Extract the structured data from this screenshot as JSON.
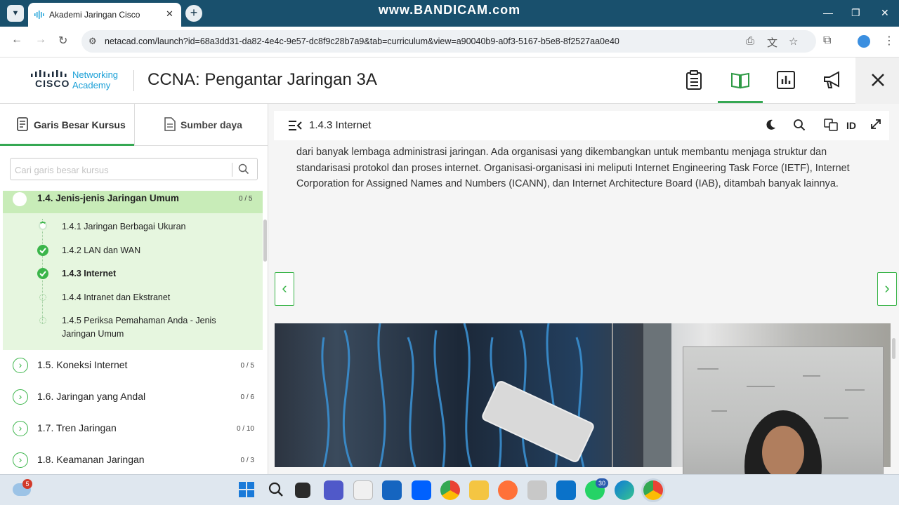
{
  "browser": {
    "tab_title": "Akademi Jaringan Cisco",
    "watermark": "www.BANDICAM.com",
    "url": "netacad.com/launch?id=68a3dd31-da82-4e4c-9e57-dc8f9c28b7a9&tab=curriculum&view=a90040b9-a0f3-5167-b5e8-8f2527aa0e40"
  },
  "header": {
    "logo_line1": "Networking",
    "logo_line2": "Academy",
    "cisco_word": "CISCO",
    "course_title": "CCNA: Pengantar Jaringan 3A"
  },
  "sidebar": {
    "tab_outline": "Garis Besar Kursus",
    "tab_resources": "Sumber daya",
    "search_placeholder": "Cari garis besar kursus",
    "active_module": {
      "title": "1.4. Jenis-jenis Jaringan Umum",
      "count": "0 / 5",
      "lessons": [
        {
          "label": "1.4.1 Jaringan Berbagai Ukuran",
          "status": "partial"
        },
        {
          "label": "1.4.2 LAN dan WAN",
          "status": "done"
        },
        {
          "label": "1.4.3 Internet",
          "status": "done"
        },
        {
          "label": "1.4.4 Intranet dan Ekstranet",
          "status": "empty"
        },
        {
          "label": "1.4.5 Periksa Pemahaman Anda - Jenis Jaringan Umum",
          "status": "empty"
        }
      ]
    },
    "modules": [
      {
        "title": "1.5. Koneksi Internet",
        "count": "0 / 5"
      },
      {
        "title": "1.6. Jaringan yang Andal",
        "count": "0 / 6"
      },
      {
        "title": "1.7. Tren Jaringan",
        "count": "0 / 10"
      },
      {
        "title": "1.8. Keamanan Jaringan",
        "count": "0 / 3"
      }
    ]
  },
  "content": {
    "lesson_title": "1.4.3 Internet",
    "lang_code": "ID",
    "paragraph": "dari banyak lembaga administrasi jaringan. Ada organisasi yang dikembangkan untuk membantu menjaga struktur dan standarisasi protokol dan proses internet. Organisasi-organisasi ini meliputi Internet Engineering Task Force (IETF), Internet Corporation for Assigned Names and Numbers (ICANN), dan Internet Architecture Board (IAB), ditambah banyak lainnya."
  },
  "taskbar": {
    "weather_badge": "5",
    "whatsapp_badge": "30"
  },
  "colors": {
    "accent_green": "#3bb54a",
    "titlebar": "#19506d",
    "cisco_blue": "#1ba0d7"
  }
}
